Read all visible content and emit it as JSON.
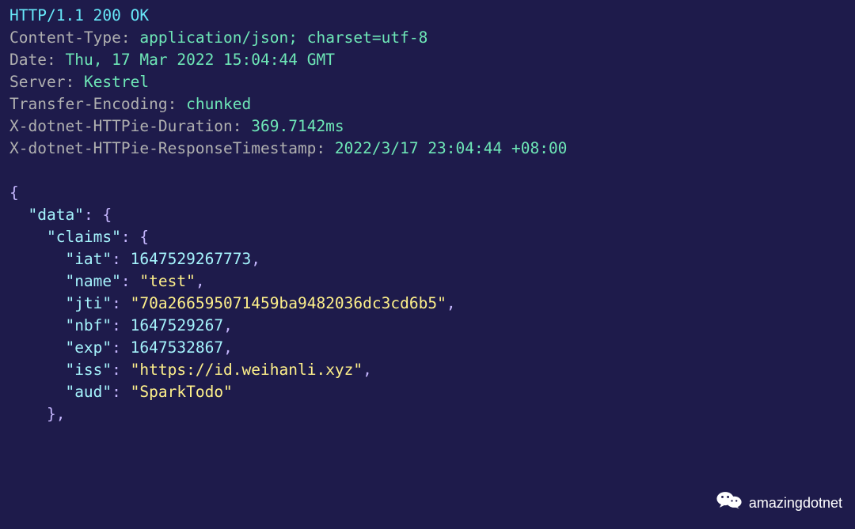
{
  "response": {
    "status_line": "HTTP/1.1 200 OK",
    "headers": [
      {
        "name": "Content-Type",
        "value": "application/json; charset=utf-8"
      },
      {
        "name": "Date",
        "value": "Thu, 17 Mar 2022 15:04:44 GMT"
      },
      {
        "name": "Server",
        "value": "Kestrel"
      },
      {
        "name": "Transfer-Encoding",
        "value": "chunked"
      },
      {
        "name": "X-dotnet-HTTPie-Duration",
        "value": "369.7142ms"
      },
      {
        "name": "X-dotnet-HTTPie-ResponseTimestamp",
        "value": "2022/3/17 23:04:44 +08:00"
      }
    ],
    "body_lines": [
      {
        "text": "{",
        "cls": "p"
      },
      {
        "indent": 1,
        "kv": {
          "key": "data",
          "after": "{"
        }
      },
      {
        "indent": 2,
        "kv": {
          "key": "claims",
          "after": "{"
        }
      },
      {
        "indent": 3,
        "kv": {
          "key": "iat",
          "num": "1647529267773",
          "comma": true
        }
      },
      {
        "indent": 3,
        "kv": {
          "key": "name",
          "str": "test",
          "comma": true
        }
      },
      {
        "indent": 3,
        "kv": {
          "key": "jti",
          "str": "70a266595071459ba9482036dc3cd6b5",
          "comma": true
        }
      },
      {
        "indent": 3,
        "kv": {
          "key": "nbf",
          "num": "1647529267",
          "comma": true
        }
      },
      {
        "indent": 3,
        "kv": {
          "key": "exp",
          "num": "1647532867",
          "comma": true
        }
      },
      {
        "indent": 3,
        "kv": {
          "key": "iss",
          "str": "https://id.weihanli.xyz",
          "comma": true
        }
      },
      {
        "indent": 3,
        "kv": {
          "key": "aud",
          "str": "SparkTodo"
        }
      },
      {
        "indent": 2,
        "close": "},"
      }
    ]
  },
  "watermark": {
    "label": "amazingdotnet"
  }
}
